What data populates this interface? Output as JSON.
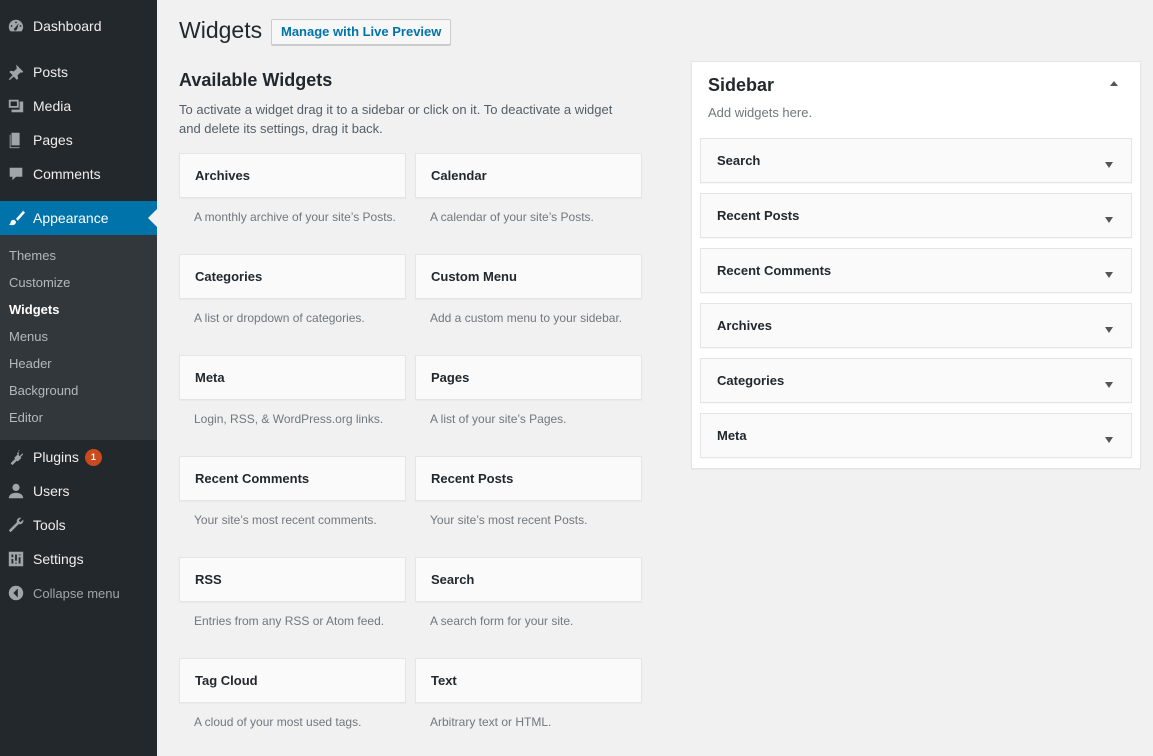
{
  "menu": {
    "dashboard": "Dashboard",
    "posts": "Posts",
    "media": "Media",
    "pages": "Pages",
    "comments": "Comments",
    "appearance": "Appearance",
    "submenu": {
      "themes": "Themes",
      "customize": "Customize",
      "widgets": "Widgets",
      "menus": "Menus",
      "header": "Header",
      "background": "Background",
      "editor": "Editor"
    },
    "plugins": "Plugins",
    "plugins_badge": "1",
    "users": "Users",
    "tools": "Tools",
    "settings": "Settings",
    "collapse": "Collapse menu"
  },
  "page": {
    "title": "Widgets",
    "preview_button": "Manage with Live Preview"
  },
  "available": {
    "title": "Available Widgets",
    "description": "To activate a widget drag it to a sidebar or click on it. To deactivate a widget and delete its settings, drag it back.",
    "widgets": [
      {
        "name": "Archives",
        "desc": "A monthly archive of your site’s Posts."
      },
      {
        "name": "Calendar",
        "desc": "A calendar of your site’s Posts."
      },
      {
        "name": "Categories",
        "desc": "A list or dropdown of categories."
      },
      {
        "name": "Custom Menu",
        "desc": "Add a custom menu to your sidebar."
      },
      {
        "name": "Meta",
        "desc": "Login, RSS, & WordPress.org links."
      },
      {
        "name": "Pages",
        "desc": "A list of your site’s Pages."
      },
      {
        "name": "Recent Comments",
        "desc": "Your site’s most recent comments."
      },
      {
        "name": "Recent Posts",
        "desc": "Your site’s most recent Posts."
      },
      {
        "name": "RSS",
        "desc": "Entries from any RSS or Atom feed."
      },
      {
        "name": "Search",
        "desc": "A search form for your site."
      },
      {
        "name": "Tag Cloud",
        "desc": "A cloud of your most used tags."
      },
      {
        "name": "Text",
        "desc": "Arbitrary text or HTML."
      }
    ]
  },
  "sidebar": {
    "name": "Sidebar",
    "description": "Add widgets here.",
    "widgets": [
      "Search",
      "Recent Posts",
      "Recent Comments",
      "Archives",
      "Categories",
      "Meta"
    ]
  },
  "colors": {
    "menu_bg": "#23282d",
    "submenu_bg": "#32373c",
    "accent": "#0073aa",
    "badge": "#ca4a1f",
    "page_bg": "#f1f1f1"
  }
}
